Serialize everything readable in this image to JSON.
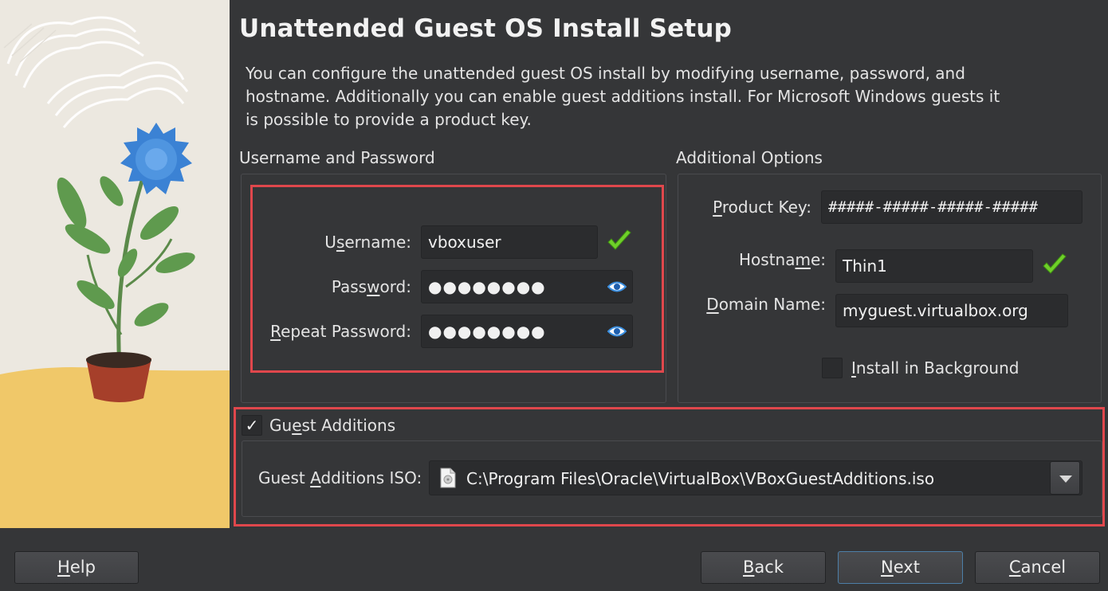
{
  "page": {
    "title": "Unattended Guest OS Install Setup",
    "description": "You can configure the unattended guest OS install by modifying username, password, and hostname. Additionally you can enable guest additions install. For Microsoft Windows guests it is possible to provide a product key."
  },
  "credentials": {
    "group_label": "Username and Password",
    "username_label_pre": "U",
    "username_label_u": "s",
    "username_label_post": "ername:",
    "username_value": "vboxuser",
    "password_label_pre": "Pass",
    "password_label_u": "w",
    "password_label_post": "ord:",
    "password_value": "●●●●●●●●",
    "repeat_label_u": "R",
    "repeat_label_post": "epeat Password:",
    "repeat_value": "●●●●●●●●"
  },
  "options": {
    "group_label": "Additional Options",
    "product_key_label_u": "P",
    "product_key_label_post": "roduct Key:",
    "product_key_value": "#####-#####-#####-#####",
    "hostname_label_pre": "Hostna",
    "hostname_label_u": "m",
    "hostname_label_post": "e:",
    "hostname_value": "Thin1",
    "domain_label_u": "D",
    "domain_label_post": "omain Name:",
    "domain_value": "myguest.virtualbox.org",
    "install_bg_label_u": "I",
    "install_bg_label_post": "nstall in Background",
    "install_bg_checked": false
  },
  "guest_additions": {
    "label_pre": "Gu",
    "label_u": "e",
    "label_post": "st Additions",
    "checked": true,
    "check_glyph": "✓",
    "iso_label_pre": "Guest ",
    "iso_label_u": "A",
    "iso_label_post": "dditions ISO:",
    "iso_path": "C:\\Program Files\\Oracle\\VirtualBox\\VBoxGuestAdditions.iso"
  },
  "buttons": {
    "help": "H",
    "help_rest": "elp",
    "back": "B",
    "back_rest": "ack",
    "next": "N",
    "next_rest": "ext",
    "cancel": "C",
    "cancel_rest": "ancel"
  },
  "colors": {
    "highlight_border": "#e0474c",
    "valid_check": "#6fcf2a",
    "eye_icon": "#3b8fe0"
  }
}
